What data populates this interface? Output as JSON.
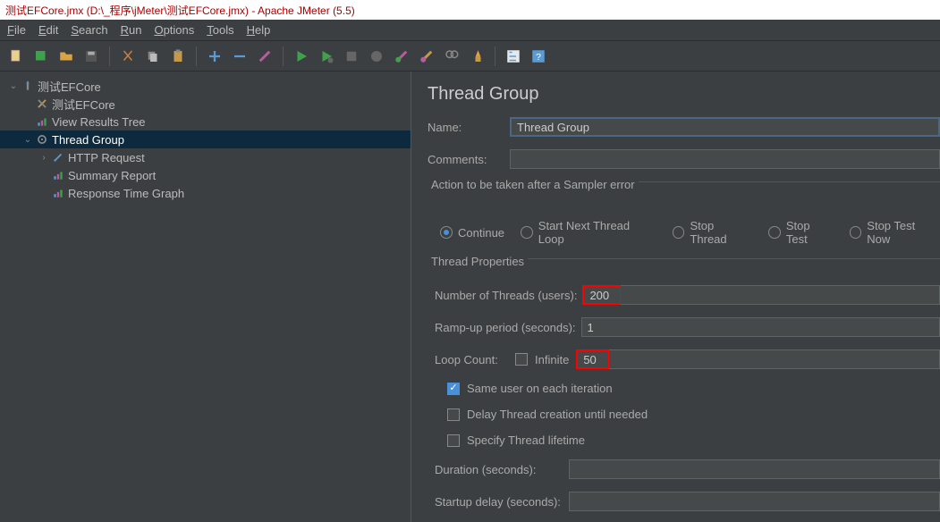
{
  "title_red": "测试EFCore.jmx (D:\\_程序\\jMeter\\测试EFCore.jmx) - Apache JMeter (5.5)",
  "menu": {
    "file": "File",
    "edit": "Edit",
    "search": "Search",
    "run": "Run",
    "options": "Options",
    "tools": "Tools",
    "help": "Help"
  },
  "tree": {
    "root": "测试EFCore",
    "child1": "测试EFCore",
    "child2": "View Results Tree",
    "tg": "Thread Group",
    "http": "HTTP Request",
    "summary": "Summary Report",
    "rtg": "Response Time Graph"
  },
  "panel": {
    "heading": "Thread Group",
    "name_label": "Name:",
    "name_value": "Thread Group",
    "comments_label": "Comments:",
    "comments_value": "",
    "action_legend": "Action to be taken after a Sampler error",
    "radio_continue": "Continue",
    "radio_startnext": "Start Next Thread Loop",
    "radio_stopthread": "Stop Thread",
    "radio_stoptest": "Stop Test",
    "radio_stoptestnow": "Stop Test Now",
    "thread_props": "Thread Properties",
    "num_threads_label": "Number of Threads (users):",
    "num_threads_value": "200",
    "rampup_label": "Ramp-up period (seconds):",
    "rampup_value": "1",
    "loop_label": "Loop Count:",
    "infinite": "Infinite",
    "loop_value": "50",
    "same_user": "Same user on each iteration",
    "delay_thread": "Delay Thread creation until needed",
    "specify_lifetime": "Specify Thread lifetime",
    "duration_label": "Duration (seconds):",
    "duration_value": "",
    "startup_label": "Startup delay (seconds):",
    "startup_value": ""
  }
}
